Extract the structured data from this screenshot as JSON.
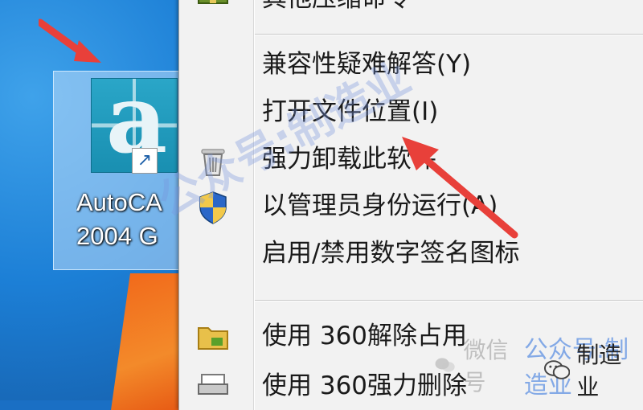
{
  "desktop": {
    "shortcut": {
      "glyph": "a",
      "label_line1": "AutoCA",
      "label_line2": "2004 G",
      "badge": "↗"
    }
  },
  "context_menu": {
    "items": [
      {
        "label": "其他压缩命令",
        "icon": "compress-icon"
      },
      {
        "label": "兼容性疑难解答(Y)",
        "icon": ""
      },
      {
        "label": "打开文件位置(I)",
        "icon": ""
      },
      {
        "label": "强力卸载此软件",
        "icon": "trash-icon"
      },
      {
        "label": "以管理员身份运行(A)",
        "icon": "uac-shield-icon"
      },
      {
        "label": "启用/禁用数字签名图标",
        "icon": ""
      },
      {
        "label": "使用 360解除占用",
        "icon": "folder-unlock-icon"
      },
      {
        "label": "使用 360强力删除",
        "icon": "shredder-icon"
      }
    ]
  },
  "watermark": {
    "diagonal": "公众号:制造业",
    "bottom_faint": "微信号",
    "bottom_blue": "公众号:制造业",
    "badge_text": "制造业"
  },
  "colors": {
    "annotation_arrow": "#e8403a",
    "menu_background": "#f2f2f2",
    "selection_tile": "#bedcfa"
  }
}
